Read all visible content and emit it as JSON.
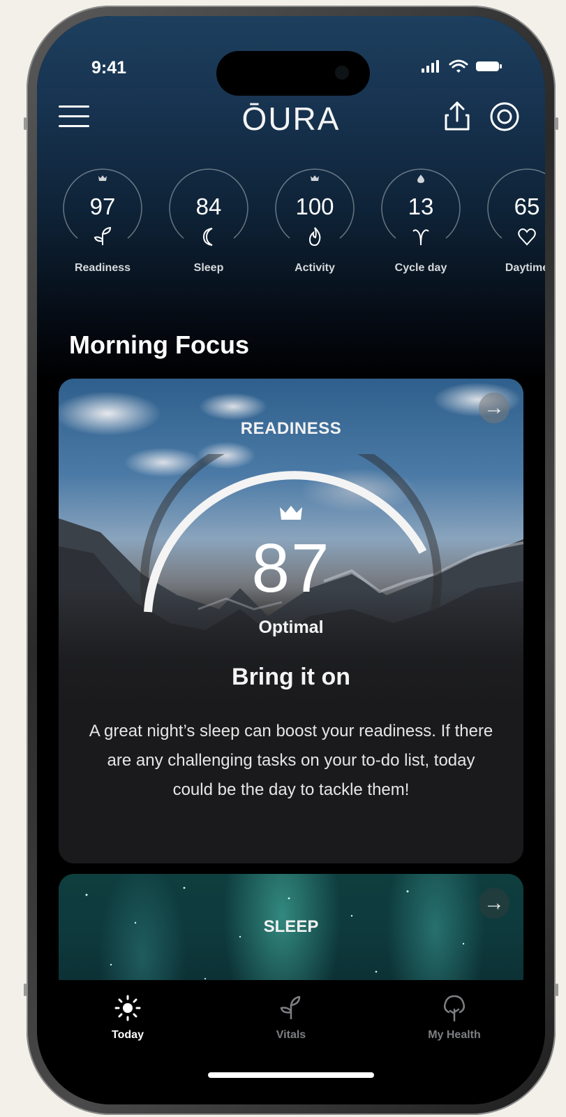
{
  "status": {
    "time": "9:41"
  },
  "header": {
    "logo": "ŌURA"
  },
  "scores": [
    {
      "value": "97",
      "label": "Readiness",
      "icon": "readiness-sprout-icon",
      "badge": "crown-icon"
    },
    {
      "value": "84",
      "label": "Sleep",
      "icon": "moon-icon",
      "badge": ""
    },
    {
      "value": "100",
      "label": "Activity",
      "icon": "flame-icon",
      "badge": "crown-icon"
    },
    {
      "value": "13",
      "label": "Cycle day",
      "icon": "cycle-icon",
      "badge": "drop-icon"
    },
    {
      "value": "65",
      "label": "Daytime",
      "icon": "heart-icon",
      "badge": ""
    }
  ],
  "section": {
    "title": "Morning Focus"
  },
  "readiness_card": {
    "kicker": "READINESS",
    "score": "87",
    "state": "Optimal",
    "headline": "Bring it on",
    "body": "A great night’s sleep can boost your readiness. If there are any challenging tasks on your to-do list, today could be the day to tackle them!"
  },
  "sleep_card": {
    "kicker": "SLEEP"
  },
  "tabs": [
    {
      "label": "Today",
      "active": true
    },
    {
      "label": "Vitals",
      "active": false
    },
    {
      "label": "My Health",
      "active": false
    }
  ],
  "colors": {
    "accent": "#ffffff",
    "inactive_tab": "#7d7f83",
    "card_bg": "#1a1a1c"
  }
}
